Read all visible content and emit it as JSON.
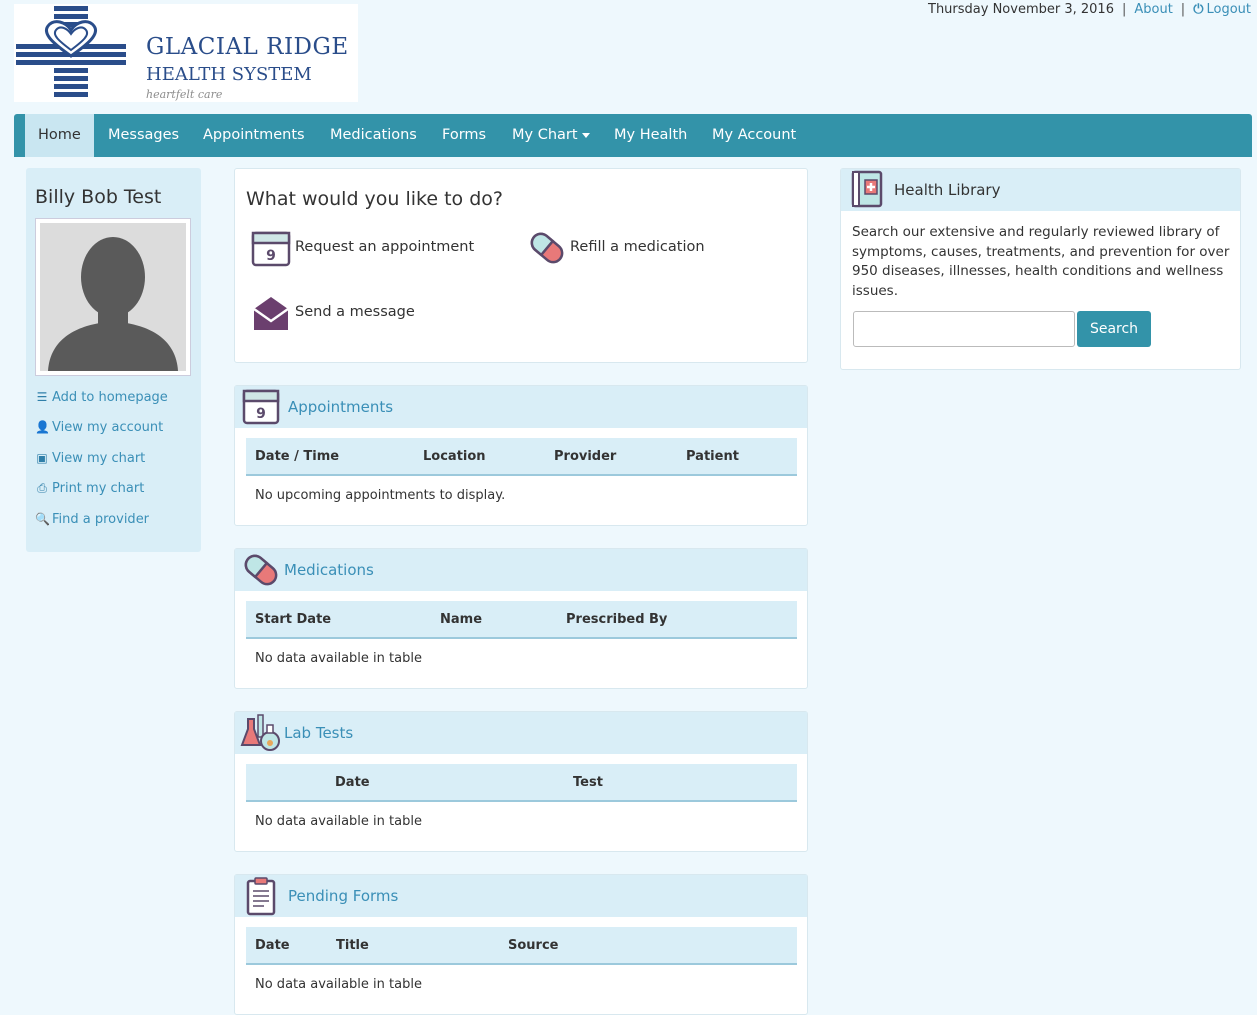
{
  "header": {
    "logo_title": "GLACIAL RIDGE",
    "logo_subtitle": "HEALTH SYSTEM",
    "logo_tagline": "heartfelt care",
    "date": "Thursday November 3, 2016",
    "about": "About",
    "logout": "Logout"
  },
  "nav": {
    "items": [
      "Home",
      "Messages",
      "Appointments",
      "Medications",
      "Forms",
      "My Chart",
      "My Health",
      "My Account"
    ],
    "active": "Home"
  },
  "sidebar": {
    "user_name": "Billy Bob Test",
    "links": [
      "Add to homepage",
      "View my account",
      "View my chart",
      "Print my chart",
      "Find a provider"
    ]
  },
  "quick": {
    "title": "What would you like to do?",
    "request_appointment": "Request an appointment",
    "refill_medication": "Refill a medication",
    "send_message": "Send a message",
    "calendar_day": "9"
  },
  "appointments": {
    "title": "Appointments",
    "calendar_day": "9",
    "columns": [
      "Date / Time",
      "Location",
      "Provider",
      "Patient"
    ],
    "empty": "No upcoming appointments to display."
  },
  "medications": {
    "title": "Medications",
    "columns": [
      "Start Date",
      "Name",
      "Prescribed By"
    ],
    "empty": "No data available in table"
  },
  "lab_tests": {
    "title": "Lab Tests",
    "columns": [
      "Date",
      "Test"
    ],
    "empty": "No data available in table"
  },
  "pending_forms": {
    "title": "Pending Forms",
    "columns": [
      "Date",
      "Title",
      "Source"
    ],
    "empty": "No data available in table"
  },
  "health_library": {
    "title": "Health Library",
    "description": "Search our extensive and regularly reviewed library of symptoms, causes, treatments, and prevention for over 950 diseases, illnesses, health conditions and wellness issues.",
    "search_value": "",
    "search_button": "Search"
  },
  "colors": {
    "nav": "#3393a9",
    "panel_header": "#d9eef7",
    "link": "#3a8fb7",
    "logo": "#2a4d8a"
  }
}
